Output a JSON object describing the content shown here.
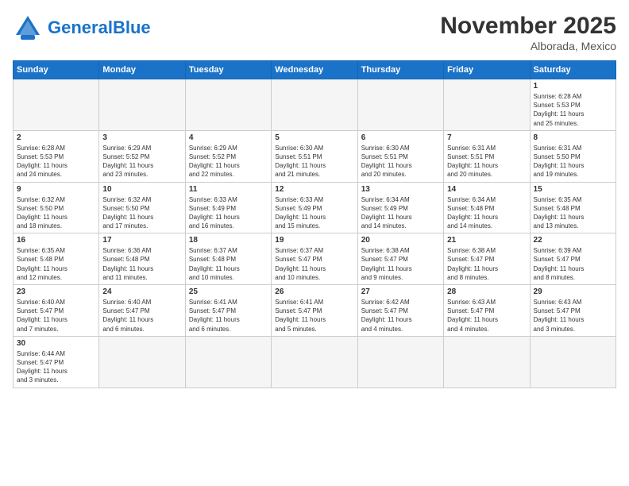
{
  "header": {
    "logo_general": "General",
    "logo_blue": "Blue",
    "month_title": "November 2025",
    "subtitle": "Alborada, Mexico"
  },
  "days_of_week": [
    "Sunday",
    "Monday",
    "Tuesday",
    "Wednesday",
    "Thursday",
    "Friday",
    "Saturday"
  ],
  "weeks": [
    [
      {
        "day": "",
        "info": ""
      },
      {
        "day": "",
        "info": ""
      },
      {
        "day": "",
        "info": ""
      },
      {
        "day": "",
        "info": ""
      },
      {
        "day": "",
        "info": ""
      },
      {
        "day": "",
        "info": ""
      },
      {
        "day": "1",
        "info": "Sunrise: 6:28 AM\nSunset: 5:53 PM\nDaylight: 11 hours\nand 25 minutes."
      }
    ],
    [
      {
        "day": "2",
        "info": "Sunrise: 6:28 AM\nSunset: 5:53 PM\nDaylight: 11 hours\nand 24 minutes."
      },
      {
        "day": "3",
        "info": "Sunrise: 6:29 AM\nSunset: 5:52 PM\nDaylight: 11 hours\nand 23 minutes."
      },
      {
        "day": "4",
        "info": "Sunrise: 6:29 AM\nSunset: 5:52 PM\nDaylight: 11 hours\nand 22 minutes."
      },
      {
        "day": "5",
        "info": "Sunrise: 6:30 AM\nSunset: 5:51 PM\nDaylight: 11 hours\nand 21 minutes."
      },
      {
        "day": "6",
        "info": "Sunrise: 6:30 AM\nSunset: 5:51 PM\nDaylight: 11 hours\nand 20 minutes."
      },
      {
        "day": "7",
        "info": "Sunrise: 6:31 AM\nSunset: 5:51 PM\nDaylight: 11 hours\nand 20 minutes."
      },
      {
        "day": "8",
        "info": "Sunrise: 6:31 AM\nSunset: 5:50 PM\nDaylight: 11 hours\nand 19 minutes."
      }
    ],
    [
      {
        "day": "9",
        "info": "Sunrise: 6:32 AM\nSunset: 5:50 PM\nDaylight: 11 hours\nand 18 minutes."
      },
      {
        "day": "10",
        "info": "Sunrise: 6:32 AM\nSunset: 5:50 PM\nDaylight: 11 hours\nand 17 minutes."
      },
      {
        "day": "11",
        "info": "Sunrise: 6:33 AM\nSunset: 5:49 PM\nDaylight: 11 hours\nand 16 minutes."
      },
      {
        "day": "12",
        "info": "Sunrise: 6:33 AM\nSunset: 5:49 PM\nDaylight: 11 hours\nand 15 minutes."
      },
      {
        "day": "13",
        "info": "Sunrise: 6:34 AM\nSunset: 5:49 PM\nDaylight: 11 hours\nand 14 minutes."
      },
      {
        "day": "14",
        "info": "Sunrise: 6:34 AM\nSunset: 5:48 PM\nDaylight: 11 hours\nand 14 minutes."
      },
      {
        "day": "15",
        "info": "Sunrise: 6:35 AM\nSunset: 5:48 PM\nDaylight: 11 hours\nand 13 minutes."
      }
    ],
    [
      {
        "day": "16",
        "info": "Sunrise: 6:35 AM\nSunset: 5:48 PM\nDaylight: 11 hours\nand 12 minutes."
      },
      {
        "day": "17",
        "info": "Sunrise: 6:36 AM\nSunset: 5:48 PM\nDaylight: 11 hours\nand 11 minutes."
      },
      {
        "day": "18",
        "info": "Sunrise: 6:37 AM\nSunset: 5:48 PM\nDaylight: 11 hours\nand 10 minutes."
      },
      {
        "day": "19",
        "info": "Sunrise: 6:37 AM\nSunset: 5:47 PM\nDaylight: 11 hours\nand 10 minutes."
      },
      {
        "day": "20",
        "info": "Sunrise: 6:38 AM\nSunset: 5:47 PM\nDaylight: 11 hours\nand 9 minutes."
      },
      {
        "day": "21",
        "info": "Sunrise: 6:38 AM\nSunset: 5:47 PM\nDaylight: 11 hours\nand 8 minutes."
      },
      {
        "day": "22",
        "info": "Sunrise: 6:39 AM\nSunset: 5:47 PM\nDaylight: 11 hours\nand 8 minutes."
      }
    ],
    [
      {
        "day": "23",
        "info": "Sunrise: 6:40 AM\nSunset: 5:47 PM\nDaylight: 11 hours\nand 7 minutes."
      },
      {
        "day": "24",
        "info": "Sunrise: 6:40 AM\nSunset: 5:47 PM\nDaylight: 11 hours\nand 6 minutes."
      },
      {
        "day": "25",
        "info": "Sunrise: 6:41 AM\nSunset: 5:47 PM\nDaylight: 11 hours\nand 6 minutes."
      },
      {
        "day": "26",
        "info": "Sunrise: 6:41 AM\nSunset: 5:47 PM\nDaylight: 11 hours\nand 5 minutes."
      },
      {
        "day": "27",
        "info": "Sunrise: 6:42 AM\nSunset: 5:47 PM\nDaylight: 11 hours\nand 4 minutes."
      },
      {
        "day": "28",
        "info": "Sunrise: 6:43 AM\nSunset: 5:47 PM\nDaylight: 11 hours\nand 4 minutes."
      },
      {
        "day": "29",
        "info": "Sunrise: 6:43 AM\nSunset: 5:47 PM\nDaylight: 11 hours\nand 3 minutes."
      }
    ],
    [
      {
        "day": "30",
        "info": "Sunrise: 6:44 AM\nSunset: 5:47 PM\nDaylight: 11 hours\nand 3 minutes."
      },
      {
        "day": "",
        "info": ""
      },
      {
        "day": "",
        "info": ""
      },
      {
        "day": "",
        "info": ""
      },
      {
        "day": "",
        "info": ""
      },
      {
        "day": "",
        "info": ""
      },
      {
        "day": "",
        "info": ""
      }
    ]
  ]
}
